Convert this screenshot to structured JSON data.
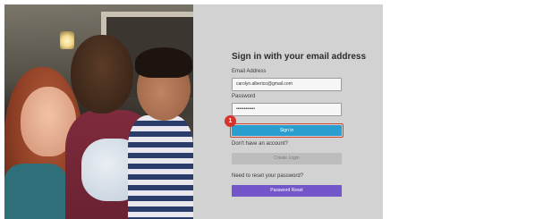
{
  "signin_form": {
    "title": "Sign in with your email address",
    "email_label": "Email Address",
    "email_value": "carolyn.alberico@gmail.com",
    "password_label": "Password",
    "password_value": "••••••••••••",
    "signin_button": "Sign in",
    "no_account_text": "Don't have an account?",
    "create_login_button": "Create Login",
    "reset_text": "Need to reset your password?",
    "password_reset_button": "Password Reset"
  },
  "annotation": {
    "step_number": "1"
  },
  "colors": {
    "panel_bg": "#d2d2d3",
    "signin_button": "#2a9fcf",
    "create_login_button": "#bdbdbd",
    "password_reset_button": "#7356c9",
    "highlight_outline": "#d2452f",
    "step_badge": "#d8322b"
  }
}
